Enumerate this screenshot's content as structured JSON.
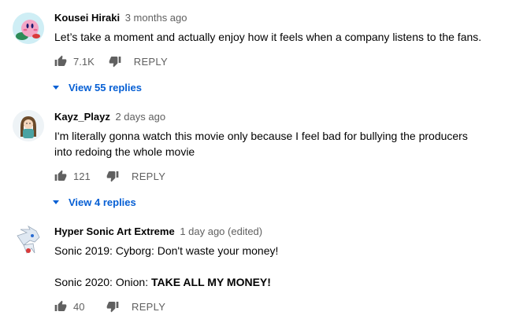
{
  "comments": [
    {
      "author": "Kousei Hiraki",
      "time": "3 months ago",
      "lines": [
        "Let’s take a moment and actually enjoy how it feels when a company listens to the fans."
      ],
      "likes": "7.1K",
      "reply_label": "REPLY",
      "view_replies": "View 55 replies"
    },
    {
      "author": "Kayz_Playz",
      "time": "2 days ago",
      "lines": [
        "I'm literally gonna watch this movie only because I feel bad for bullying the producers",
        "into redoing the whole movie"
      ],
      "likes": "121",
      "reply_label": "REPLY",
      "view_replies": "View 4 replies"
    },
    {
      "author": "Hyper Sonic Art Extreme",
      "time": "1 day ago (edited)",
      "line1": "Sonic 2019: Cyborg: Don't waste your money!",
      "line2_prefix": "Sonic 2020: Onion: ",
      "line2_bold": "TAKE ALL MY MONEY!",
      "likes": "40",
      "reply_label": "REPLY"
    }
  ],
  "colors": {
    "link": "#065fd4",
    "meta": "#606060",
    "text": "#030303"
  },
  "icons": [
    "thumb-up-icon",
    "thumb-down-icon",
    "expand-triangle-icon",
    "kirby-avatar",
    "girl-avatar",
    "sonic-avatar"
  ]
}
